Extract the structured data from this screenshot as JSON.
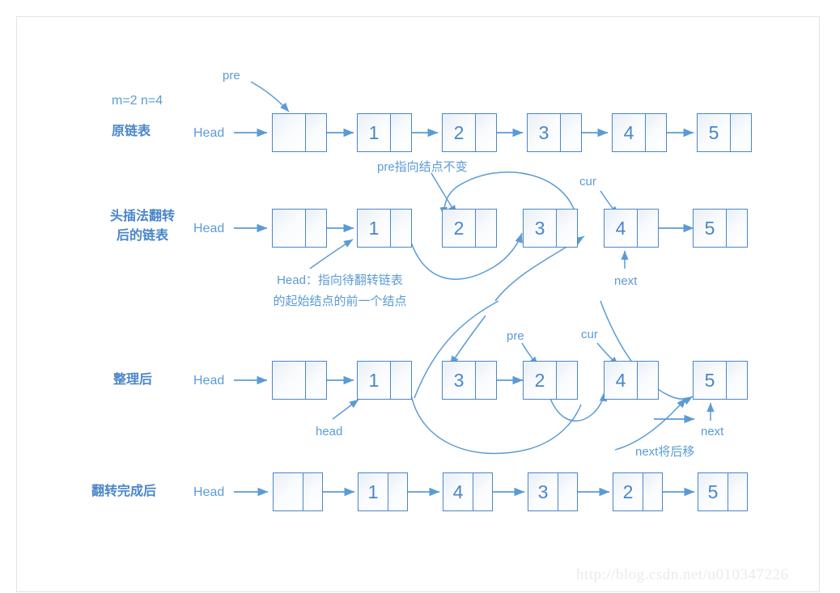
{
  "diagram": {
    "title_note": "m=2 n=4",
    "watermark": "http://blog.csdn.net/u010347226",
    "accent_color": "#5b9bd5",
    "node_border_color": "#4a86c8",
    "frame_color": "#e3e3e3"
  },
  "rows": [
    {
      "id": "original-list",
      "label": "原链表",
      "head_label": "Head",
      "nodes": [
        "",
        "1",
        "2",
        "3",
        "4",
        "5"
      ]
    },
    {
      "id": "head-insert-reversed-list",
      "label_line1": "头插法翻转",
      "label_line2": "后的链表",
      "head_label": "Head",
      "nodes": [
        "",
        "1",
        "2",
        "3",
        "4",
        "5"
      ]
    },
    {
      "id": "after-tidy",
      "label": "整理后",
      "head_label": "Head",
      "nodes": [
        "",
        "1",
        "3",
        "2",
        "4",
        "5"
      ]
    },
    {
      "id": "reverse-complete",
      "label": "翻转完成后",
      "head_label": "Head",
      "nodes": [
        "",
        "1",
        "4",
        "3",
        "2",
        "5"
      ]
    }
  ],
  "annotations": {
    "pre_row1": "pre",
    "pre_unchanged": "pre指向结点不变",
    "cur_row2": "cur",
    "next_row2": "next",
    "head_explain_line1": "Head：指向待翻转链表",
    "head_explain_line2": "的起始结点的前一个结点",
    "head_lower_row3": "head",
    "pre_row3": "pre",
    "cur_row3": "cur",
    "next_row3": "next",
    "next_will_move": "next将后移"
  }
}
